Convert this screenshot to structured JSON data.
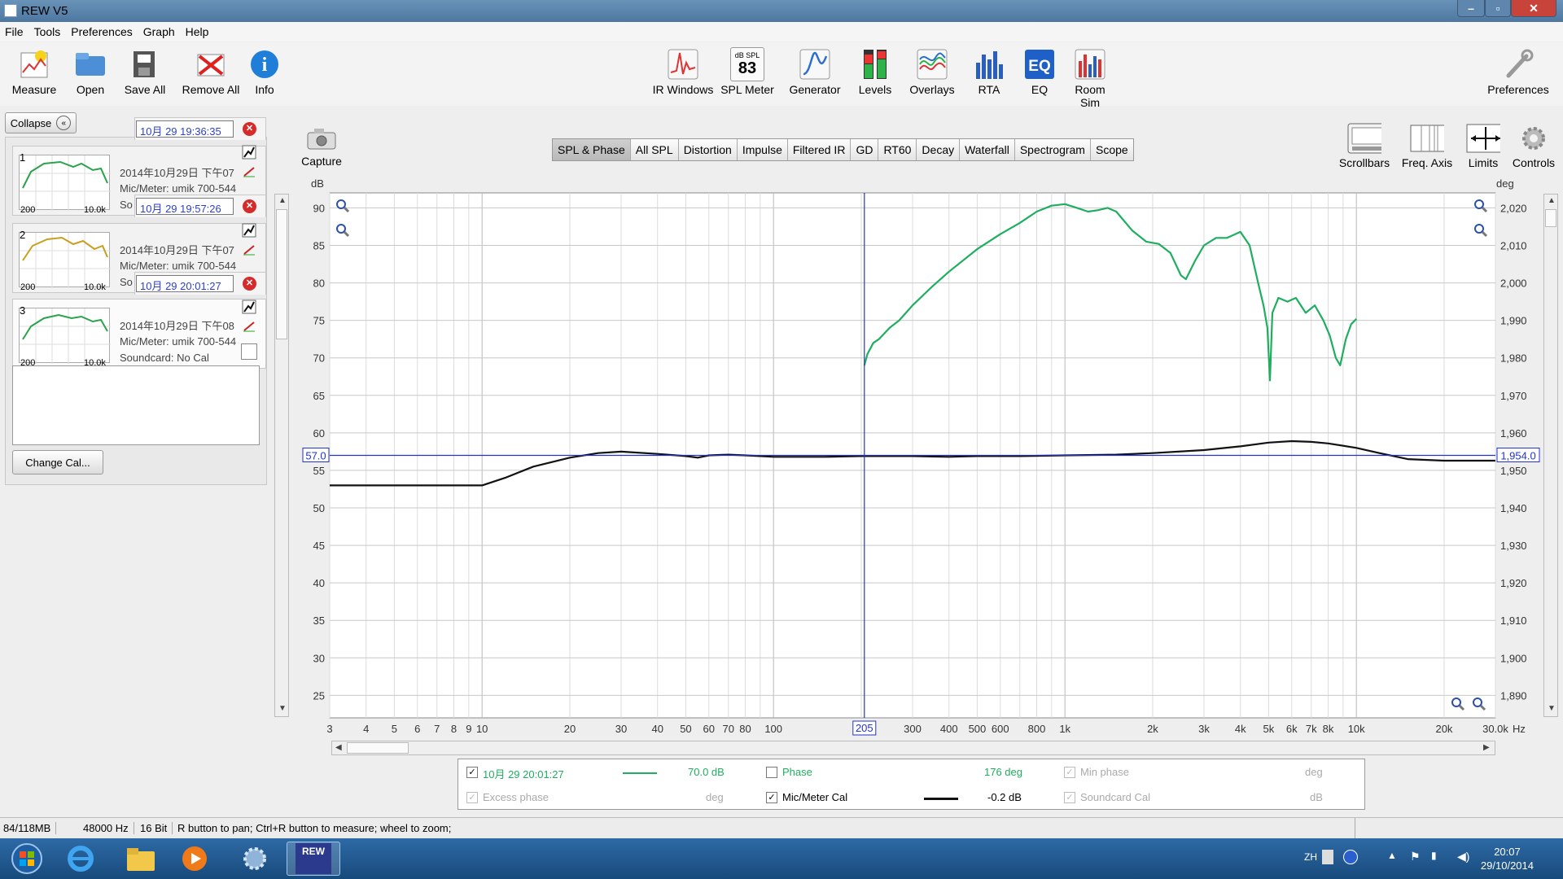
{
  "window": {
    "title": "REW V5"
  },
  "menu": [
    "File",
    "Tools",
    "Preferences",
    "Graph",
    "Help"
  ],
  "toolbar_left": [
    "Measure",
    "Open",
    "Save All",
    "Remove All",
    "Info"
  ],
  "toolbar_center": [
    "IR Windows",
    "SPL Meter",
    "Generator",
    "Levels",
    "Overlays",
    "RTA",
    "EQ",
    "Room Sim"
  ],
  "spl_meter_value": "83",
  "spl_meter_unit": "dB SPL",
  "toolbar_right": "Preferences",
  "capture_label": "Capture",
  "graph_tools": [
    "Scrollbars",
    "Freq. Axis",
    "Limits",
    "Controls"
  ],
  "tabs": [
    "SPL & Phase",
    "All SPL",
    "Distortion",
    "Impulse",
    "Filtered IR",
    "GD",
    "RT60",
    "Decay",
    "Waterfall",
    "Spectrogram",
    "Scope"
  ],
  "collapse_label": "Collapse",
  "measurements": [
    {
      "num": "1",
      "label": "10月 29 19:36:35",
      "date": "2014年10月29日 下午07",
      "mic": "Mic/Meter: umik 700-544",
      "sound": "So",
      "color": "#2aa34a",
      "thumb_min": "200",
      "thumb_max": "10.0k"
    },
    {
      "num": "2",
      "label": "10月 29 19:57:26",
      "date": "2014年10月29日 下午07",
      "mic": "Mic/Meter: umik 700-544",
      "sound": "So",
      "color": "#c8a020",
      "thumb_min": "200",
      "thumb_max": "10.0k"
    },
    {
      "num": "3",
      "label": "10月 29 20:01:27",
      "date": "2014年10月29日 下午08",
      "mic": "Mic/Meter: umik 700-544",
      "sound": "Soundcard: No Cal",
      "color": "#2aa34a",
      "thumb_min": "200",
      "thumb_max": "10.0k"
    }
  ],
  "change_cal": "Change Cal...",
  "chart_data": {
    "type": "line",
    "y_left_unit": "dB",
    "y_right_unit": "deg",
    "x_unit": "Hz",
    "x_log": true,
    "xlim": [
      3,
      30000
    ],
    "ylim_left": [
      22,
      92
    ],
    "ylim_right": [
      1884,
      2024
    ],
    "y_left_ticks": [
      90,
      85,
      80,
      75,
      70,
      65,
      60,
      55,
      50,
      45,
      40,
      35,
      30,
      25
    ],
    "y_right_ticks": [
      "2,020",
      "2,010",
      "2,000",
      "1,990",
      "1,980",
      "1,970",
      "1,960",
      "1,950",
      "1,940",
      "1,930",
      "1,920",
      "1,910",
      "1,900",
      "1,890"
    ],
    "x_ticks": [
      {
        "v": 3,
        "t": "3"
      },
      {
        "v": 4,
        "t": "4"
      },
      {
        "v": 5,
        "t": "5"
      },
      {
        "v": 6,
        "t": "6"
      },
      {
        "v": 7,
        "t": "7"
      },
      {
        "v": 8,
        "t": "8"
      },
      {
        "v": 9,
        "t": "9"
      },
      {
        "v": 10,
        "t": "10"
      },
      {
        "v": 20,
        "t": "20"
      },
      {
        "v": 30,
        "t": "30"
      },
      {
        "v": 40,
        "t": "40"
      },
      {
        "v": 50,
        "t": "50"
      },
      {
        "v": 60,
        "t": "60"
      },
      {
        "v": 70,
        "t": "70"
      },
      {
        "v": 80,
        "t": "80"
      },
      {
        "v": 100,
        "t": "100"
      },
      {
        "v": 300,
        "t": "300"
      },
      {
        "v": 400,
        "t": "400"
      },
      {
        "v": 500,
        "t": "500"
      },
      {
        "v": 600,
        "t": "600"
      },
      {
        "v": 800,
        "t": "800"
      },
      {
        "v": 1000,
        "t": "1k"
      },
      {
        "v": 2000,
        "t": "2k"
      },
      {
        "v": 3000,
        "t": "3k"
      },
      {
        "v": 4000,
        "t": "4k"
      },
      {
        "v": 5000,
        "t": "5k"
      },
      {
        "v": 6000,
        "t": "6k"
      },
      {
        "v": 7000,
        "t": "7k"
      },
      {
        "v": 8000,
        "t": "8k"
      },
      {
        "v": 10000,
        "t": "10k"
      },
      {
        "v": 20000,
        "t": "20k"
      },
      {
        "v": 30000,
        "t": "30.0k"
      }
    ],
    "cursor_x": 205,
    "cursor_x_label": "205",
    "cursor_left_label": "57.0",
    "cursor_right_label": "1,954.0",
    "series": [
      {
        "name": "10月 29 20:01:27",
        "color": "#1fae5f",
        "points": [
          [
            205,
            69
          ],
          [
            210,
            70.5
          ],
          [
            220,
            72
          ],
          [
            230,
            72.5
          ],
          [
            250,
            74
          ],
          [
            270,
            75
          ],
          [
            300,
            77
          ],
          [
            350,
            79.5
          ],
          [
            400,
            81.5
          ],
          [
            500,
            84.5
          ],
          [
            600,
            86.5
          ],
          [
            700,
            88
          ],
          [
            800,
            89.5
          ],
          [
            900,
            90.3
          ],
          [
            1000,
            90.5
          ],
          [
            1100,
            90
          ],
          [
            1200,
            89.5
          ],
          [
            1300,
            89.7
          ],
          [
            1400,
            90
          ],
          [
            1500,
            89.5
          ],
          [
            1700,
            87
          ],
          [
            1900,
            85.5
          ],
          [
            2100,
            85.2
          ],
          [
            2300,
            84
          ],
          [
            2500,
            81
          ],
          [
            2600,
            80.5
          ],
          [
            2800,
            83
          ],
          [
            3000,
            85
          ],
          [
            3300,
            86
          ],
          [
            3600,
            86
          ],
          [
            4000,
            86.8
          ],
          [
            4300,
            85
          ],
          [
            4600,
            80
          ],
          [
            4800,
            77
          ],
          [
            4950,
            74
          ],
          [
            5050,
            67
          ],
          [
            5150,
            76
          ],
          [
            5400,
            78
          ],
          [
            5800,
            77.5
          ],
          [
            6200,
            78
          ],
          [
            6700,
            76
          ],
          [
            7200,
            77
          ],
          [
            7700,
            75
          ],
          [
            8100,
            73
          ],
          [
            8500,
            70
          ],
          [
            8800,
            69
          ],
          [
            9200,
            72.5
          ],
          [
            9600,
            74.5
          ],
          [
            10000,
            75.2
          ]
        ]
      },
      {
        "name": "Mic/Meter Cal",
        "color": "#111111",
        "points": [
          [
            3,
            53
          ],
          [
            10,
            53
          ],
          [
            12,
            54
          ],
          [
            15,
            55.5
          ],
          [
            20,
            56.7
          ],
          [
            25,
            57.3
          ],
          [
            30,
            57.5
          ],
          [
            40,
            57.2
          ],
          [
            50,
            56.9
          ],
          [
            55,
            56.7
          ],
          [
            60,
            57
          ],
          [
            70,
            57.1
          ],
          [
            80,
            57
          ],
          [
            90,
            56.9
          ],
          [
            100,
            56.8
          ],
          [
            150,
            56.8
          ],
          [
            200,
            56.9
          ],
          [
            300,
            56.9
          ],
          [
            400,
            56.8
          ],
          [
            500,
            56.9
          ],
          [
            700,
            56.9
          ],
          [
            1000,
            57
          ],
          [
            1500,
            57.1
          ],
          [
            2000,
            57.3
          ],
          [
            3000,
            57.7
          ],
          [
            4000,
            58.2
          ],
          [
            5000,
            58.7
          ],
          [
            6000,
            58.9
          ],
          [
            7000,
            58.8
          ],
          [
            8000,
            58.6
          ],
          [
            10000,
            58
          ],
          [
            12000,
            57.3
          ],
          [
            15000,
            56.5
          ],
          [
            20000,
            56.3
          ],
          [
            30000,
            56.3
          ]
        ]
      }
    ]
  },
  "legend": {
    "m_label": "10月 29 20:01:27",
    "m_value": "70.0 dB",
    "phase_label": "Phase",
    "phase_value": "176 deg",
    "min_phase_label": "Min phase",
    "min_phase_unit": "deg",
    "excess_label": "Excess phase",
    "excess_unit": "deg",
    "mic_label": "Mic/Meter Cal",
    "mic_value": "-0.2 dB",
    "sc_label": "Soundcard Cal",
    "sc_unit": "dB"
  },
  "status": {
    "mem": "84/118MB",
    "rate": "48000 Hz",
    "bits": "16 Bit",
    "hint": "R button to pan; Ctrl+R button to measure; wheel to zoom;"
  },
  "taskbar": {
    "lang": "ZH",
    "time": "20:07",
    "date": "29/10/2014",
    "rew_label": "REW"
  },
  "colors": {
    "accent": "#2b3fd0",
    "green": "#1fae5f",
    "cursor": "#2233cc"
  }
}
